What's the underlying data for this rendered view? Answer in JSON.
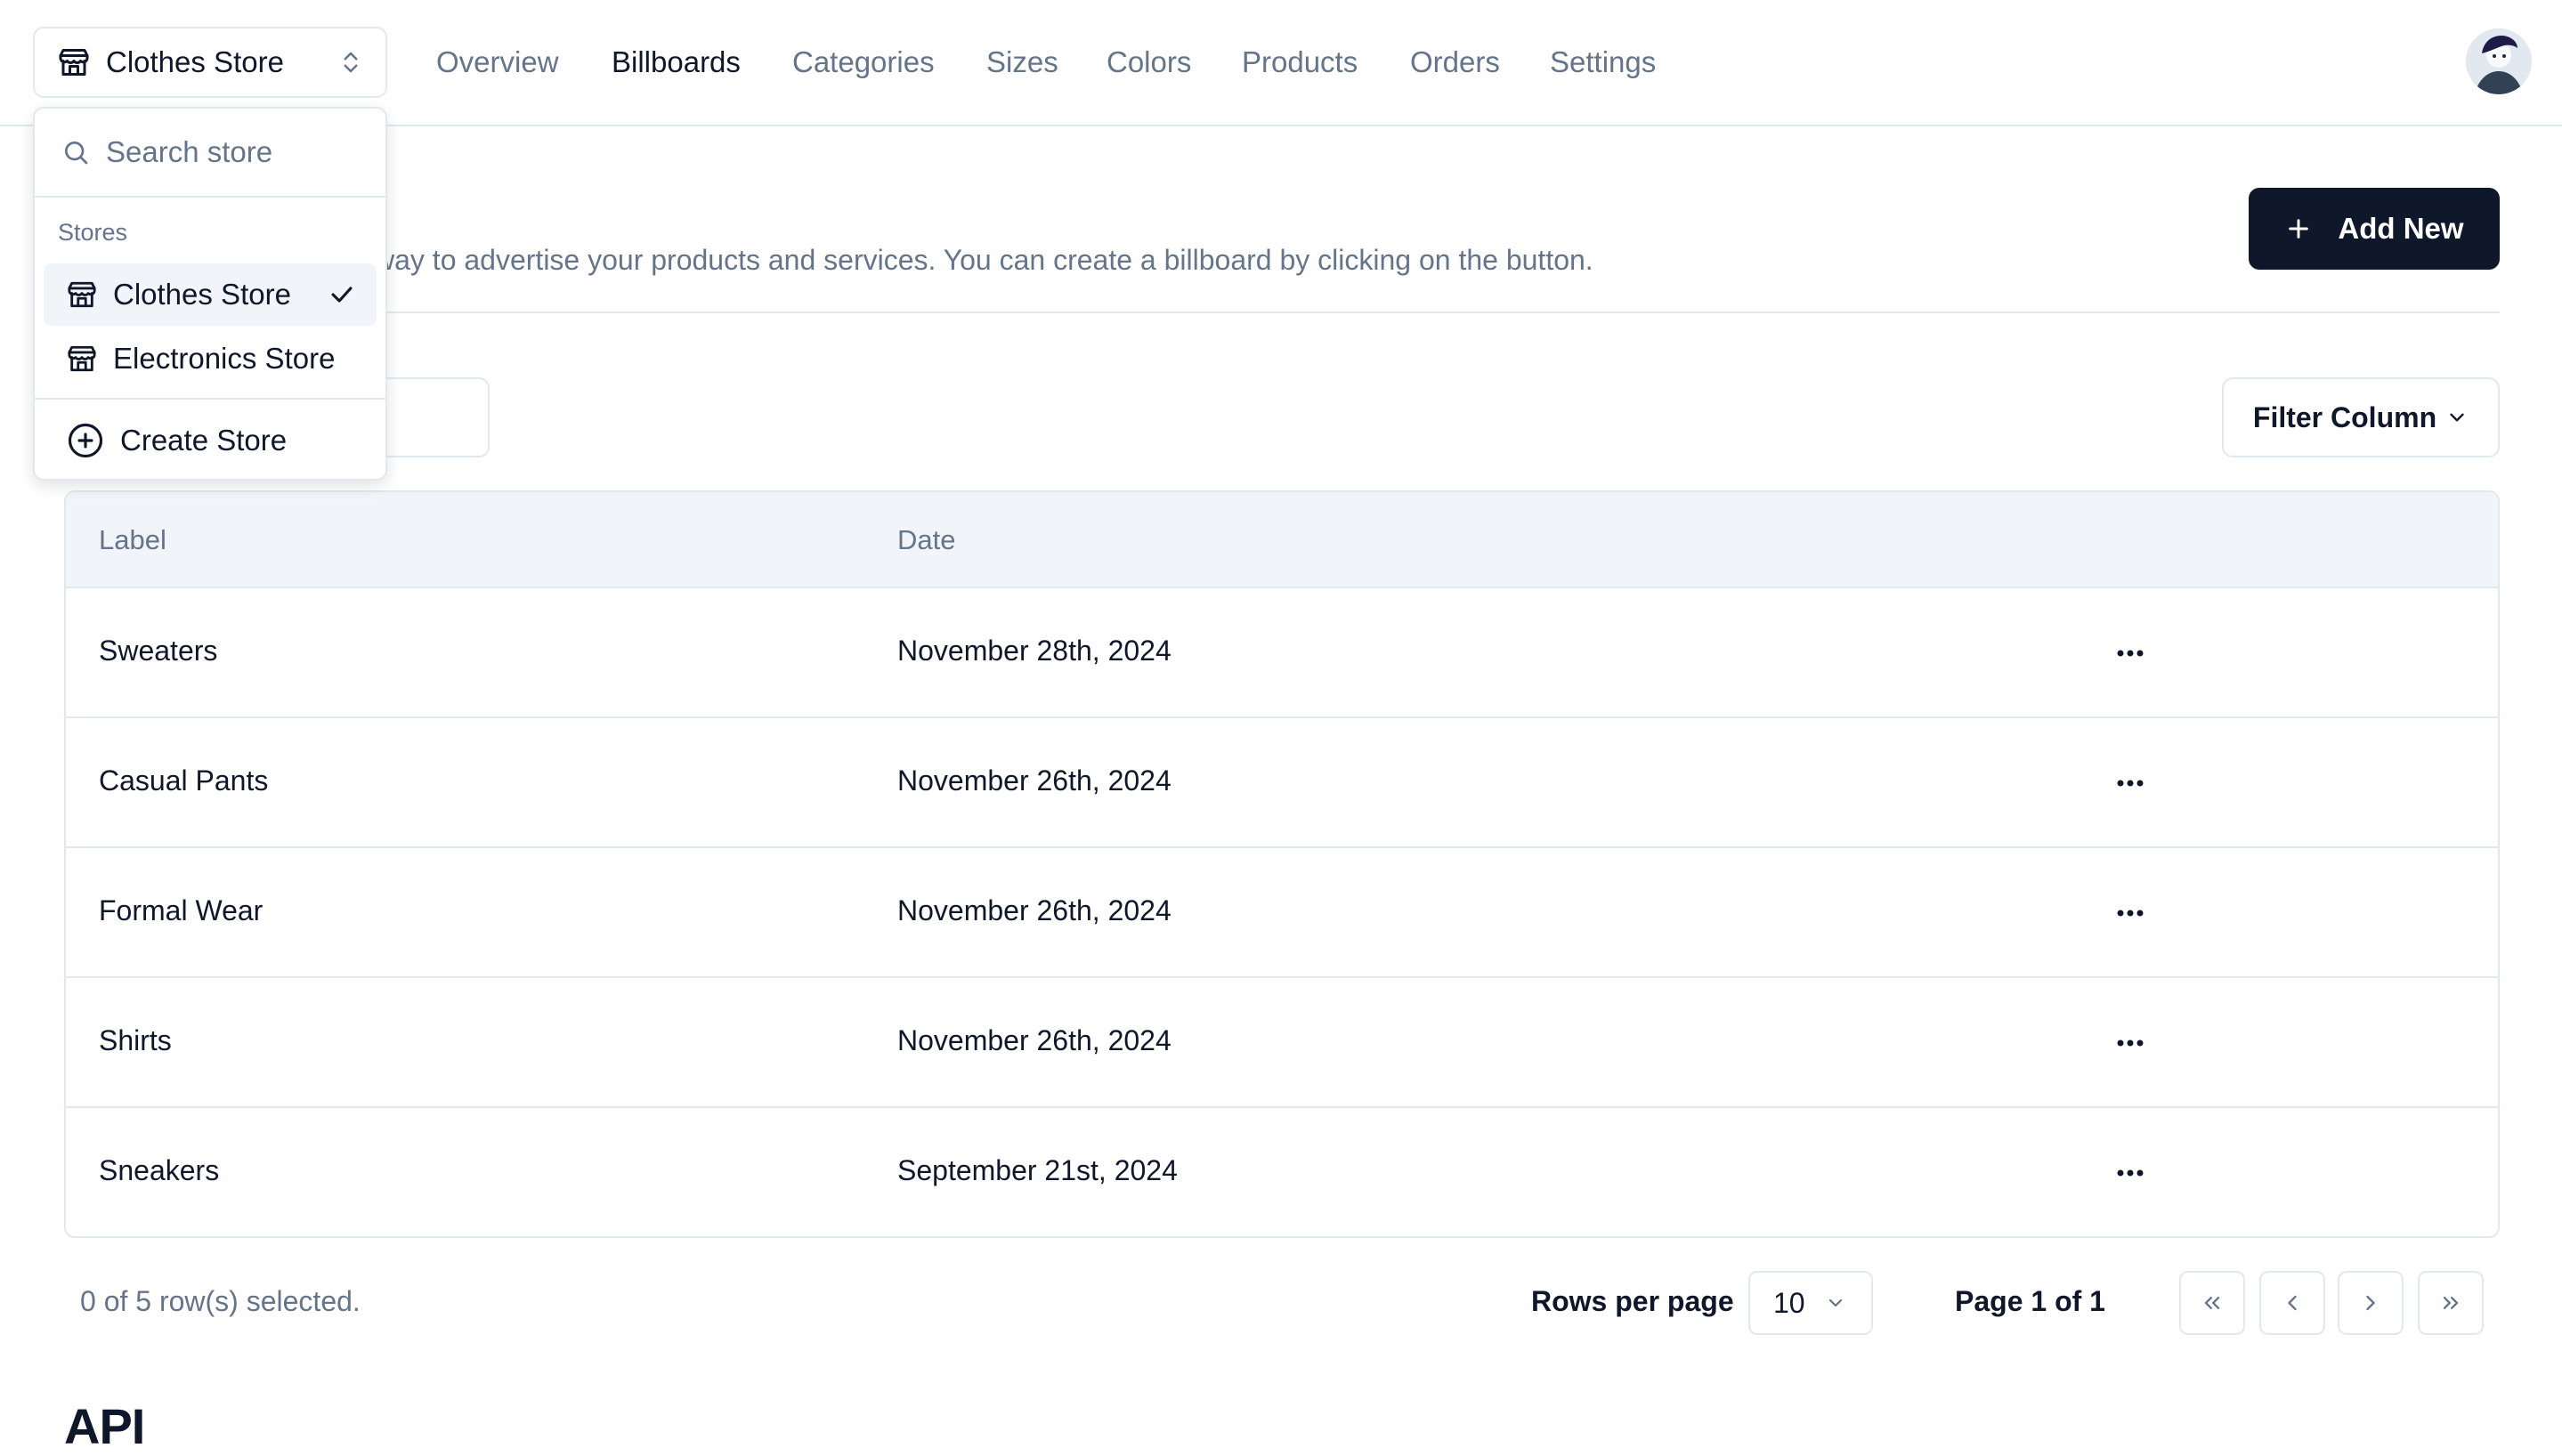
{
  "nav": {
    "store_name": "Clothes Store",
    "links": [
      "Overview",
      "Billboards",
      "Categories",
      "Sizes",
      "Colors",
      "Products",
      "Orders",
      "Settings"
    ],
    "active_link": "Billboards"
  },
  "page": {
    "description_visible": "way to advertise your products and services. You can create a billboard by clicking on the button.",
    "add_new_label": "Add New",
    "filter_label": "Filter Column"
  },
  "table": {
    "columns": [
      "Label",
      "Date"
    ],
    "rows": [
      {
        "label": "Sweaters",
        "date": "November 28th, 2024"
      },
      {
        "label": "Casual Pants",
        "date": "November 26th, 2024"
      },
      {
        "label": "Formal Wear",
        "date": "November 26th, 2024"
      },
      {
        "label": "Shirts",
        "date": "November 26th, 2024"
      },
      {
        "label": "Sneakers",
        "date": "September 21st, 2024"
      }
    ]
  },
  "footer": {
    "selected_text": "0 of 5 row(s) selected.",
    "rows_per_page_label": "Rows per page",
    "rows_per_page_value": "10",
    "page_label": "Page 1 of 1"
  },
  "api_heading": "API",
  "store_dropdown": {
    "search_placeholder": "Search store",
    "group_label": "Stores",
    "stores": [
      "Clothes Store",
      "Electronics Store"
    ],
    "selected_store": "Clothes Store",
    "create_label": "Create Store"
  },
  "colors": {
    "primary": "#0f172a",
    "muted_text": "#64748b",
    "border": "#e2e8f0",
    "header_bg": "#f1f5f9"
  }
}
